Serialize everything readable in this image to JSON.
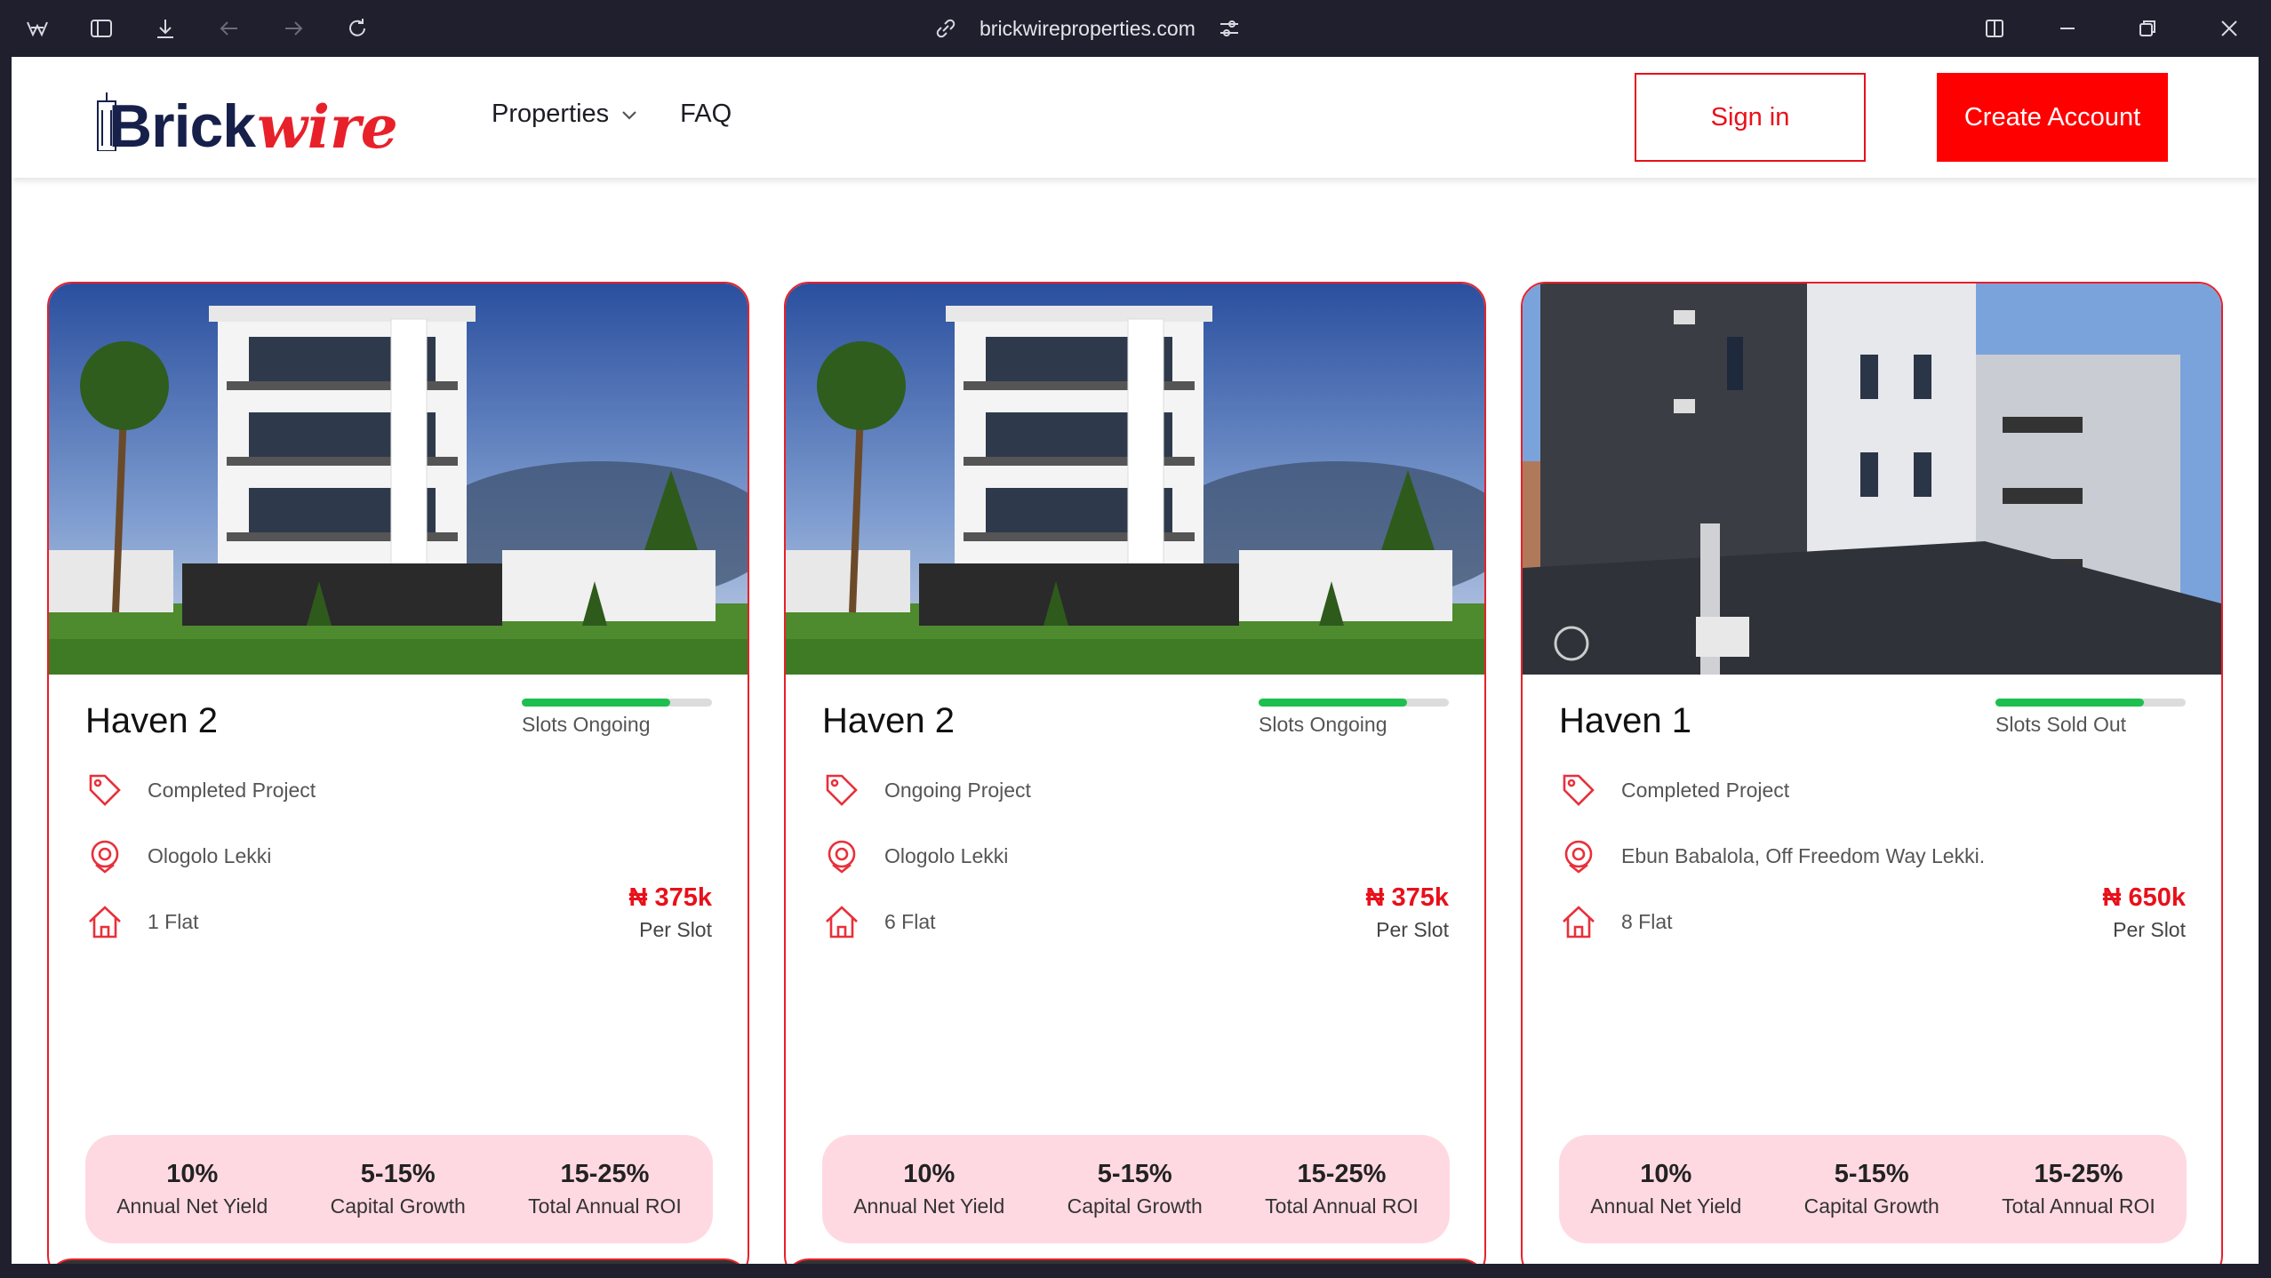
{
  "browser": {
    "url": "brickwireproperties.com"
  },
  "header": {
    "logo_brick": "Brick",
    "logo_wire": "wire",
    "nav_properties": "Properties",
    "nav_faq": "FAQ",
    "sign_in": "Sign in",
    "create_account": "Create Account"
  },
  "colors": {
    "accent": "#e8101a",
    "progress": "#1dbf4e",
    "stats_bg": "#ffd9e2"
  },
  "cards": [
    {
      "title": "Haven 2",
      "status": "Slots Ongoing",
      "progress": 0.78,
      "project": "Completed Project",
      "location": "Ologolo Lekki",
      "units": "1 Flat",
      "price": "₦ 375k",
      "per": "Per Slot",
      "stats": [
        {
          "value": "10%",
          "label": "Annual Net Yield"
        },
        {
          "value": "5-15%",
          "label": "Capital Growth"
        },
        {
          "value": "15-25%",
          "label": "Total Annual ROI"
        }
      ]
    },
    {
      "title": "Haven 2",
      "status": "Slots Ongoing",
      "progress": 0.78,
      "project": "Ongoing Project",
      "location": "Ologolo Lekki",
      "units": "6 Flat",
      "price": "₦ 375k",
      "per": "Per Slot",
      "stats": [
        {
          "value": "10%",
          "label": "Annual Net Yield"
        },
        {
          "value": "5-15%",
          "label": "Capital Growth"
        },
        {
          "value": "15-25%",
          "label": "Total Annual ROI"
        }
      ]
    },
    {
      "title": "Haven 1",
      "status": "Slots Sold Out",
      "progress": 0.78,
      "project": "Completed Project",
      "location": "Ebun Babalola, Off Freedom Way Lekki.",
      "units": "8 Flat",
      "price": "₦ 650k",
      "per": "Per Slot",
      "stats": [
        {
          "value": "10%",
          "label": "Annual Net Yield"
        },
        {
          "value": "5-15%",
          "label": "Capital Growth"
        },
        {
          "value": "15-25%",
          "label": "Total Annual ROI"
        }
      ]
    }
  ]
}
